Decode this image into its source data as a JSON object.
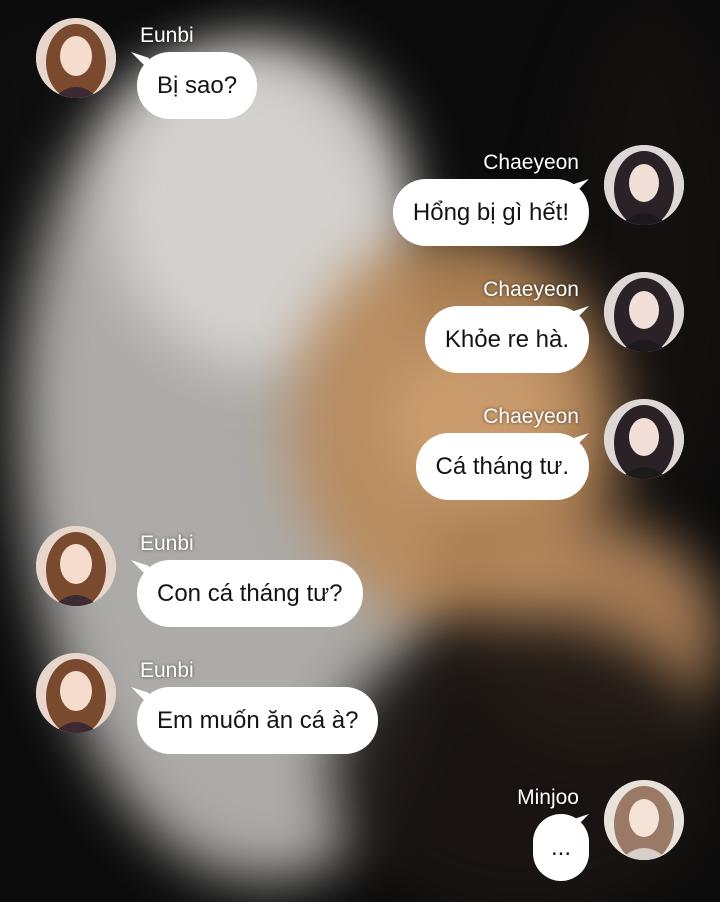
{
  "messages": [
    {
      "sender": "Eunbi",
      "text": "Bị sao?",
      "side": "left"
    },
    {
      "sender": "Chaeyeon",
      "text": "Hổng bị gì hết!",
      "side": "right"
    },
    {
      "sender": "Chaeyeon",
      "text": "Khỏe re hà.",
      "side": "right"
    },
    {
      "sender": "Chaeyeon",
      "text": "Cá tháng tư.",
      "side": "right"
    },
    {
      "sender": "Eunbi",
      "text": "Con cá tháng tư?",
      "side": "left"
    },
    {
      "sender": "Eunbi",
      "text": "Em muốn ăn cá à?",
      "side": "left"
    },
    {
      "sender": "Minjoo",
      "text": "...",
      "side": "right"
    }
  ]
}
